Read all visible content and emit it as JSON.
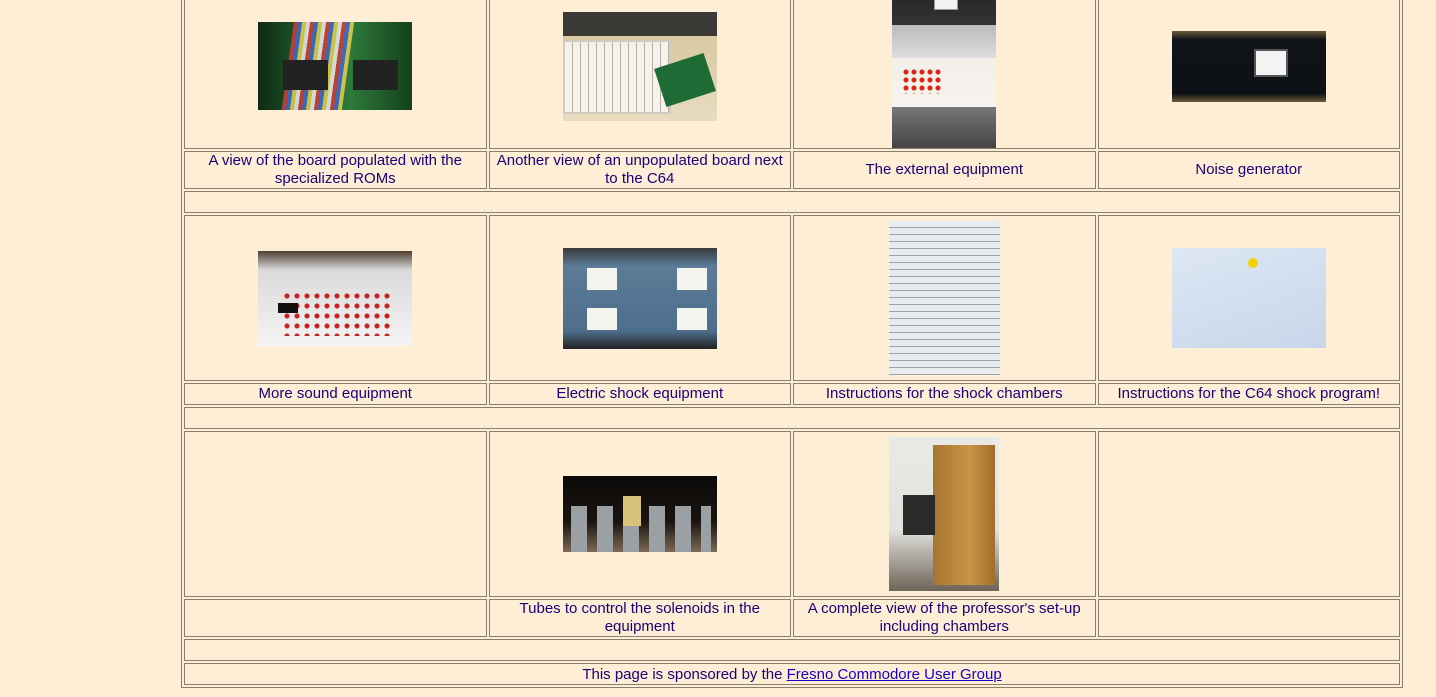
{
  "rows": [
    {
      "captions": [
        "A view of the board populated with the specialized ROMs",
        "Another view of an unpopulated board next to the C64",
        "The external equipment",
        "Noise generator"
      ]
    },
    {
      "captions": [
        "More sound equipment",
        "Electric shock equipment",
        "Instructions for the shock chambers",
        "Instructions for the C64 shock program!"
      ]
    },
    {
      "captions": [
        "",
        "Tubes to control the solenoids in the equipment",
        "A complete view of the professor's set-up including chambers",
        ""
      ]
    }
  ],
  "footer": {
    "text": "This page is sponsored by the ",
    "link_label": "Fresno Commodore User Group"
  }
}
